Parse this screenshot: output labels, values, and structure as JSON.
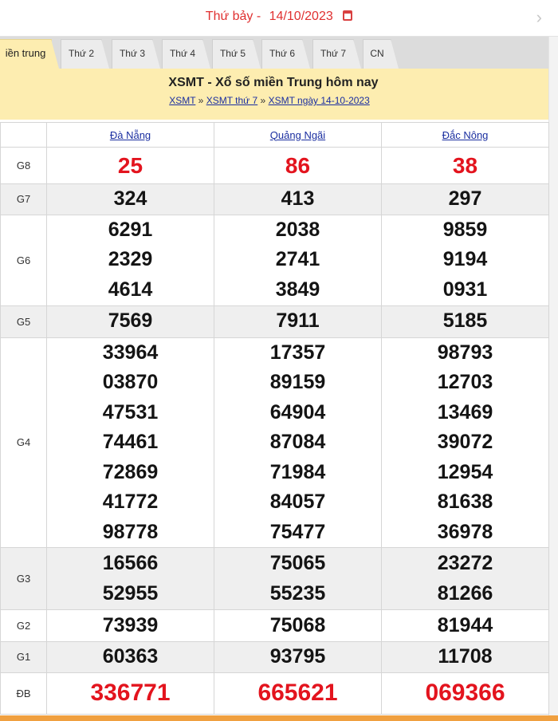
{
  "date_bar": {
    "label": "Thứ bảy -",
    "date": "14/10/2023",
    "next_icon": "chevron-right-icon",
    "calendar_icon": "calendar-icon"
  },
  "tabs": [
    {
      "label": "iền trung"
    },
    {
      "label": "Thứ 2"
    },
    {
      "label": "Thứ 3"
    },
    {
      "label": "Thứ 4"
    },
    {
      "label": "Thứ 5"
    },
    {
      "label": "Thứ 6"
    },
    {
      "label": "Thứ 7"
    },
    {
      "label": "CN"
    }
  ],
  "header": {
    "title": "XSMT - Xổ số miền Trung hôm nay",
    "breadcrumb": [
      "XSMT",
      "XSMT thứ 7",
      "XSMT ngày 14-10-2023"
    ],
    "separator": "»"
  },
  "provinces": [
    "Đà Nẵng",
    "Quảng Ngãi",
    "Đắc Nông"
  ],
  "prizes": [
    {
      "name": "G8",
      "values": [
        [
          "25"
        ],
        [
          "86"
        ],
        [
          "38"
        ]
      ]
    },
    {
      "name": "G7",
      "values": [
        [
          "324"
        ],
        [
          "413"
        ],
        [
          "297"
        ]
      ]
    },
    {
      "name": "G6",
      "values": [
        [
          "6291",
          "2329",
          "4614"
        ],
        [
          "2038",
          "2741",
          "3849"
        ],
        [
          "9859",
          "9194",
          "0931"
        ]
      ]
    },
    {
      "name": "G5",
      "values": [
        [
          "7569"
        ],
        [
          "7911"
        ],
        [
          "5185"
        ]
      ]
    },
    {
      "name": "G4",
      "values": [
        [
          "33964",
          "03870",
          "47531",
          "74461",
          "72869",
          "41772",
          "98778"
        ],
        [
          "17357",
          "89159",
          "64904",
          "87084",
          "71984",
          "84057",
          "75477"
        ],
        [
          "98793",
          "12703",
          "13469",
          "39072",
          "12954",
          "81638",
          "36978"
        ]
      ]
    },
    {
      "name": "G3",
      "values": [
        [
          "16566",
          "52955"
        ],
        [
          "75065",
          "55235"
        ],
        [
          "23272",
          "81266"
        ]
      ]
    },
    {
      "name": "G2",
      "values": [
        [
          "73939"
        ],
        [
          "75068"
        ],
        [
          "81944"
        ]
      ]
    },
    {
      "name": "G1",
      "values": [
        [
          "60363"
        ],
        [
          "93795"
        ],
        [
          "11708"
        ]
      ]
    },
    {
      "name": "ĐB",
      "values": [
        [
          "336771"
        ],
        [
          "665621"
        ],
        [
          "069366"
        ]
      ]
    }
  ],
  "colors": {
    "accent_red": "#e3141e",
    "header_bg": "#fdedb0",
    "link": "#1a2ea0"
  }
}
